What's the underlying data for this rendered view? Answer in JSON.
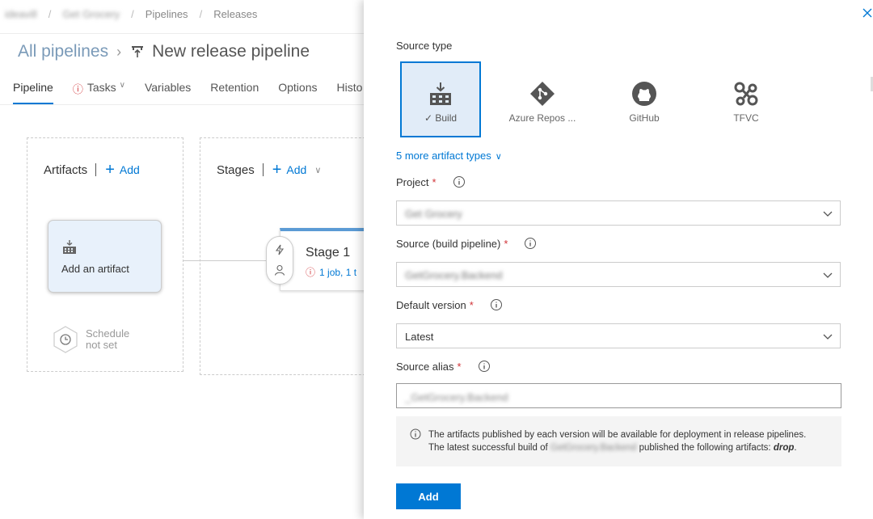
{
  "breadcrumb": {
    "org": "ideavill",
    "project": "Get Grocery",
    "items": [
      "Pipelines",
      "Releases"
    ]
  },
  "header": {
    "all_pipelines": "All pipelines",
    "pipeline_name": "New release pipeline"
  },
  "tabs": [
    {
      "label": "Pipeline"
    },
    {
      "label": "Tasks"
    },
    {
      "label": "Variables"
    },
    {
      "label": "Retention"
    },
    {
      "label": "Options"
    },
    {
      "label": "Histo"
    }
  ],
  "artifacts": {
    "title": "Artifacts",
    "add_label": "Add",
    "card_label": "Add an artifact",
    "schedule_line1": "Schedule",
    "schedule_line2": "not set"
  },
  "stages": {
    "title": "Stages",
    "add_label": "Add",
    "stage_name": "Stage 1",
    "stage_sub": "1 job, 1 t"
  },
  "panel": {
    "source_type_label": "Source type",
    "source_types": [
      {
        "label": "Build",
        "icon": "build-icon",
        "selected": true
      },
      {
        "label": "Azure Repos ...",
        "icon": "azure-repos-icon",
        "selected": false
      },
      {
        "label": "GitHub",
        "icon": "github-icon",
        "selected": false
      },
      {
        "label": "TFVC",
        "icon": "tfvc-icon",
        "selected": false
      }
    ],
    "more_types": "5 more artifact types",
    "project_label": "Project",
    "project_value": "Get Grocery",
    "source_label": "Source (build pipeline)",
    "source_value": "GetGrocery.Backend",
    "version_label": "Default version",
    "version_value": "Latest",
    "alias_label": "Source alias",
    "alias_value": "_GetGrocery.Backend",
    "info_line1": "The artifacts published by each version will be available for deployment in release pipelines.",
    "info_line2_a": "The latest successful build of",
    "info_line2_blur": "GetGrocery.Backend",
    "info_line2_b": "published the following artifacts:",
    "info_line2_c": "drop",
    "info_line2_d": ".",
    "add_button": "Add",
    "required_mark": "*"
  },
  "colors": {
    "accent": "#0078d4",
    "required": "#d13438",
    "selected_bg": "#e1ecf8"
  }
}
